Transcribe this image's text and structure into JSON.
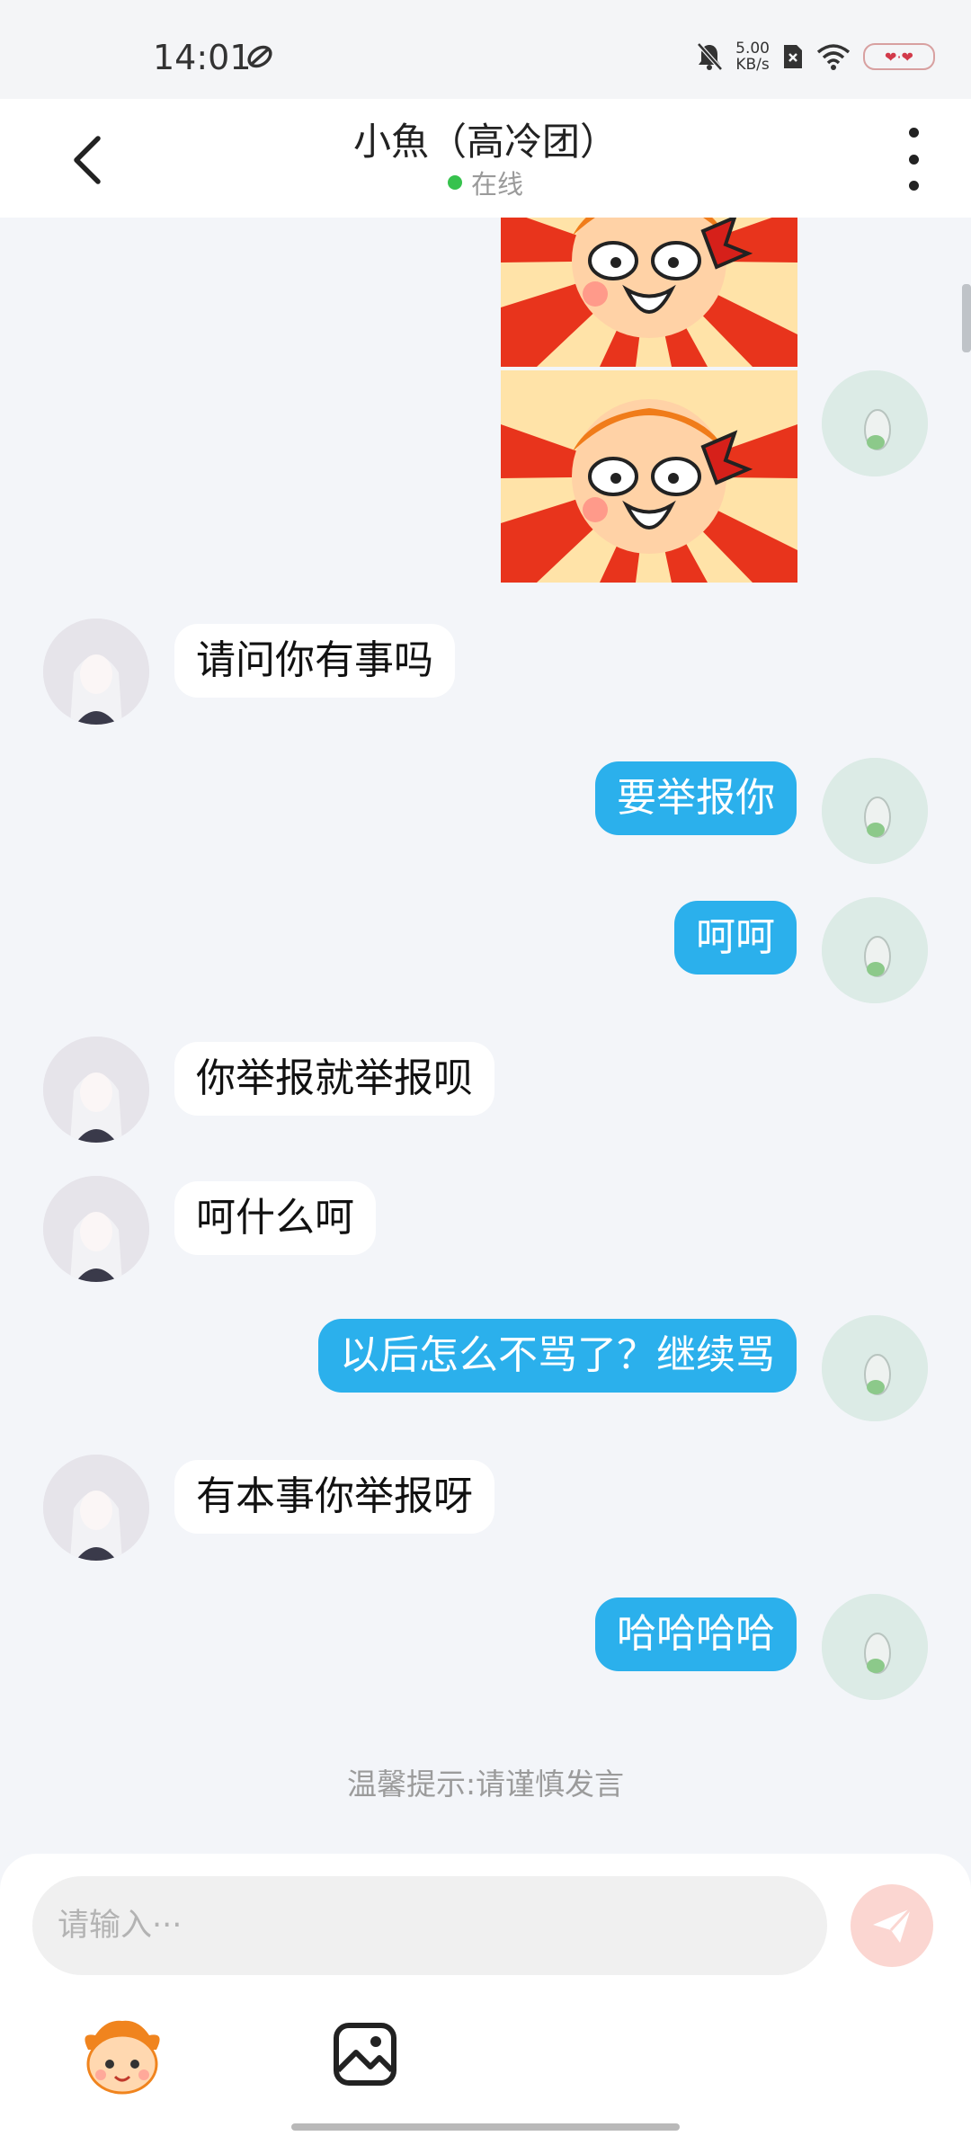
{
  "status_bar": {
    "time": "14:01",
    "net_speed_value": "5.00",
    "net_speed_unit": "KB/s",
    "battery_label": "❤·❤",
    "icons": [
      "swirl-icon",
      "mute-bell-icon",
      "sim-icon",
      "wifi-icon",
      "battery-icon"
    ]
  },
  "header": {
    "title": "小魚（高冷团）",
    "status": "在线",
    "status_color": "#36c24d"
  },
  "messages": [
    {
      "side": "right",
      "type": "sticker",
      "sticker": "angry-cartoon-sticker",
      "partial": true
    },
    {
      "side": "right",
      "type": "sticker",
      "sticker": "angry-cartoon-sticker"
    },
    {
      "side": "left",
      "type": "text",
      "text": "请问你有事吗"
    },
    {
      "side": "right",
      "type": "text",
      "text": "要举报你"
    },
    {
      "side": "right",
      "type": "text",
      "text": "呵呵"
    },
    {
      "side": "left",
      "type": "text",
      "text": "你举报就举报呗"
    },
    {
      "side": "left",
      "type": "text",
      "text": "呵什么呵"
    },
    {
      "side": "right",
      "type": "text",
      "text": "以后怎么不骂了？继续骂"
    },
    {
      "side": "left",
      "type": "text",
      "text": "有本事你举报呀"
    },
    {
      "side": "right",
      "type": "text",
      "text": "哈哈哈哈"
    }
  ],
  "tip": "温馨提示:请谨慎发言",
  "input": {
    "placeholder": "请输入···"
  },
  "colors": {
    "outgoing_bubble": "#2bb0ec",
    "incoming_bubble": "#ffffff",
    "send_button": "#fbd6d1",
    "background": "#f3f5f9"
  }
}
